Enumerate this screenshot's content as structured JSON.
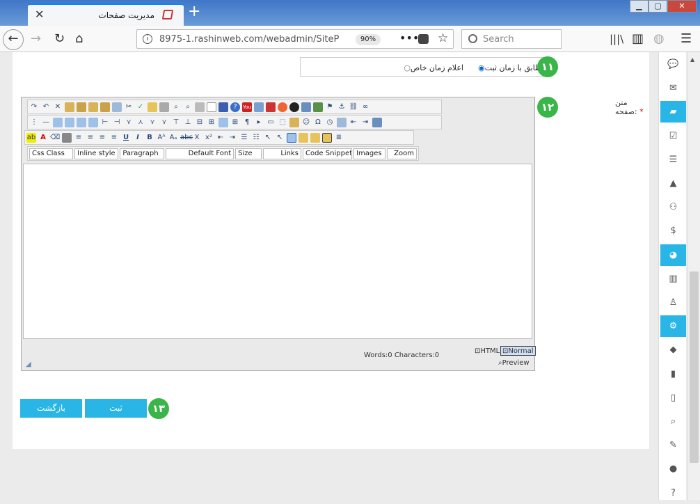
{
  "browser": {
    "tab_title": "مدیریت صفحات",
    "close_tab": "✕",
    "new_tab": "+",
    "url": "8975-1.rashinweb.com/webadmin/SiteP",
    "zoom": "90%",
    "search_placeholder": "Search",
    "menu": "☰"
  },
  "form": {
    "time_badge": "۱۱",
    "radio_registration": "مطابق با زمان ثبت",
    "radio_custom": "اعلام زمان خاص",
    "body_label": "متن صفحه:",
    "required_mark": "*",
    "editor_badge": "۱۲",
    "actions_badge": "۱۳",
    "submit_label": "ثبت",
    "back_label": "بازگشت"
  },
  "editor": {
    "dropdowns": [
      "Css Class",
      "Inline style",
      "Paragraph",
      "Default Font",
      "Size",
      "Links",
      "Code Snippet",
      "Images",
      "Zoom"
    ],
    "word_count": "Words:0 Characters:0",
    "mode_html": "HTML",
    "mode_normal": "Normal",
    "mode_preview": "Preview",
    "toolbar_row3_glyphs": [
      "A",
      "U",
      "I",
      "B",
      "X",
      "x²"
    ]
  },
  "sidebar": {
    "items": [
      "chat-icon",
      "envelope-icon",
      "folder-open-icon",
      "check-square-icon",
      "list-icon",
      "road-icon",
      "users-icon",
      "dollar-icon",
      "pie-chart-icon",
      "bar-chart-icon",
      "user-tie-icon",
      "gear-icon",
      "tags-icon",
      "book-icon",
      "file-icon",
      "zoom-icon",
      "wrench-icon",
      "globe-icon",
      "question-icon"
    ],
    "active": [
      2,
      8,
      11
    ],
    "accent": "#29b6e6"
  }
}
